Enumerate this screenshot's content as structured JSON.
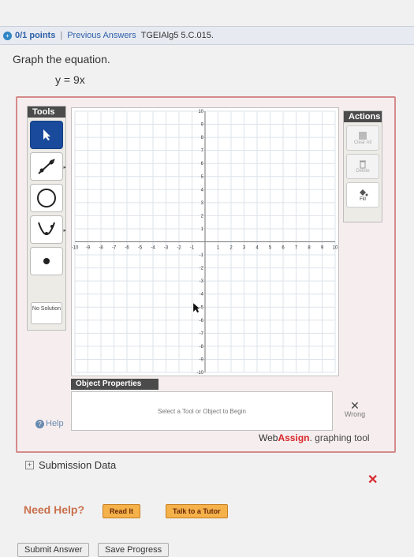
{
  "header": {
    "points": "0/1 points",
    "separator": "|",
    "previous_answers": "Previous Answers",
    "question_id": "TGEIAlg5 5.C.015."
  },
  "question": {
    "prompt": "Graph the equation.",
    "equation": "y = 9x"
  },
  "tools": {
    "title": "Tools",
    "no_solution": "No Solution",
    "items": [
      "pointer-tool",
      "line-tool",
      "circle-tool",
      "parabola-tool",
      "point-tool"
    ]
  },
  "actions": {
    "title": "Actions",
    "clear_all": "Clear All",
    "delete": "Delete",
    "fill": "Fill"
  },
  "graph": {
    "x_ticks": [
      -10,
      -9,
      -8,
      -7,
      -6,
      -5,
      -4,
      -3,
      -2,
      -1,
      1,
      2,
      3,
      4,
      5,
      6,
      7,
      8,
      9,
      10
    ],
    "y_ticks": [
      10,
      9,
      8,
      7,
      6,
      5,
      4,
      3,
      2,
      1,
      -1,
      -2,
      -3,
      -4,
      -5,
      -6,
      -7,
      -8,
      -9,
      -10
    ],
    "xlim": [
      -10,
      10
    ],
    "ylim": [
      -10,
      10
    ],
    "grid": true
  },
  "object_properties": {
    "title": "Object Properties",
    "hint": "Select a Tool or Object to Begin"
  },
  "status": {
    "help": "Help",
    "result": "Wrong"
  },
  "brand": {
    "web": "Web",
    "assign": "Assign",
    "suffix": ". graphing tool"
  },
  "submission": {
    "label": "Submission Data"
  },
  "need_help": {
    "label": "Need Help?",
    "read_it": "Read It",
    "talk_to_tutor": "Talk to a Tutor"
  },
  "footer": {
    "submit": "Submit Answer",
    "save": "Save Progress"
  },
  "colors": {
    "brand_red": "#d8262a",
    "selected_tool": "#1a4a9b",
    "frame_border": "#d48a8a",
    "help_button": "#f5b14a"
  }
}
